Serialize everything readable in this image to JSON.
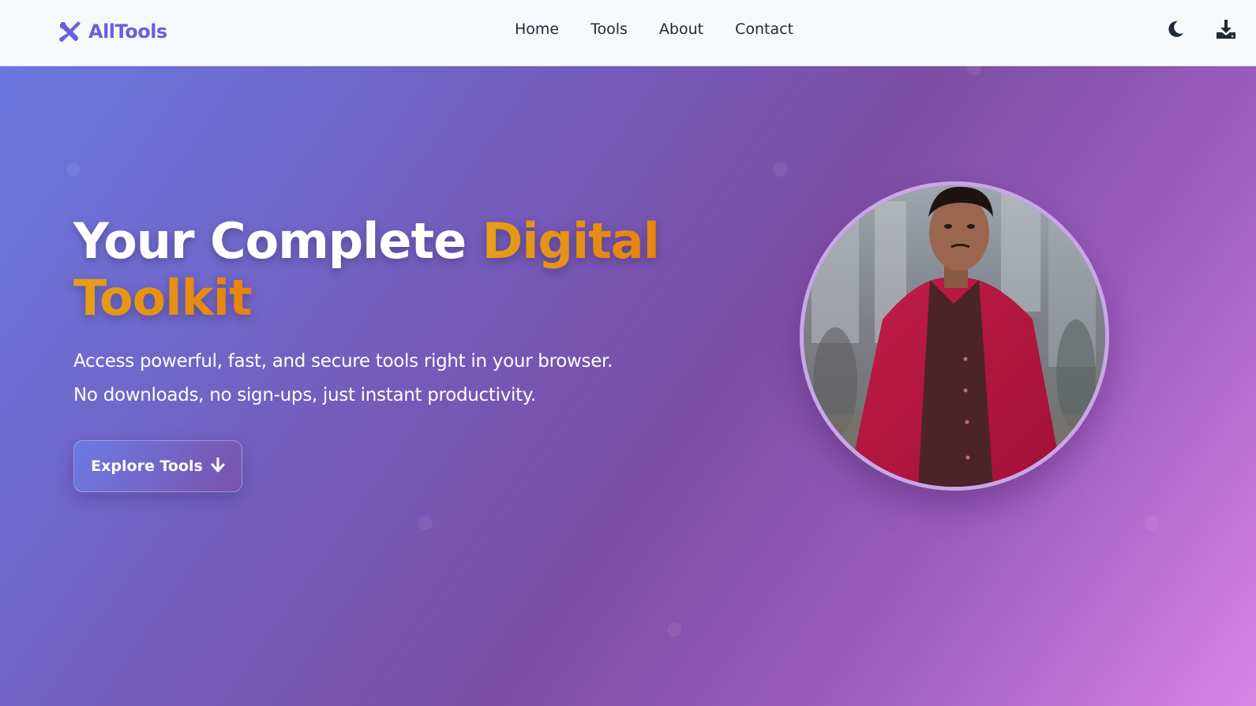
{
  "brand": {
    "name": "AllTools",
    "icon": "tools-icon",
    "color": "#6a60d8"
  },
  "nav": {
    "links": [
      {
        "label": "Home"
      },
      {
        "label": "Tools"
      },
      {
        "label": "About"
      },
      {
        "label": "Contact"
      }
    ],
    "actions": [
      {
        "icon": "moon-icon"
      },
      {
        "icon": "download-icon"
      }
    ]
  },
  "hero": {
    "title_part1": "Your Complete ",
    "title_accent_1": "Digital",
    "title_accent_2": "Toolkit",
    "subtitle_line1": "Access powerful, fast, and secure tools right in your browser.",
    "subtitle_line2": "No downloads, no sign-ups, just instant productivity.",
    "cta_label": "Explore Tools",
    "cta_icon": "arrow-down-icon",
    "accent_color": "#e39f1a",
    "gradient_start": "#6a78df",
    "gradient_end": "#d885e6"
  },
  "profile": {
    "image": "profile-photo"
  }
}
